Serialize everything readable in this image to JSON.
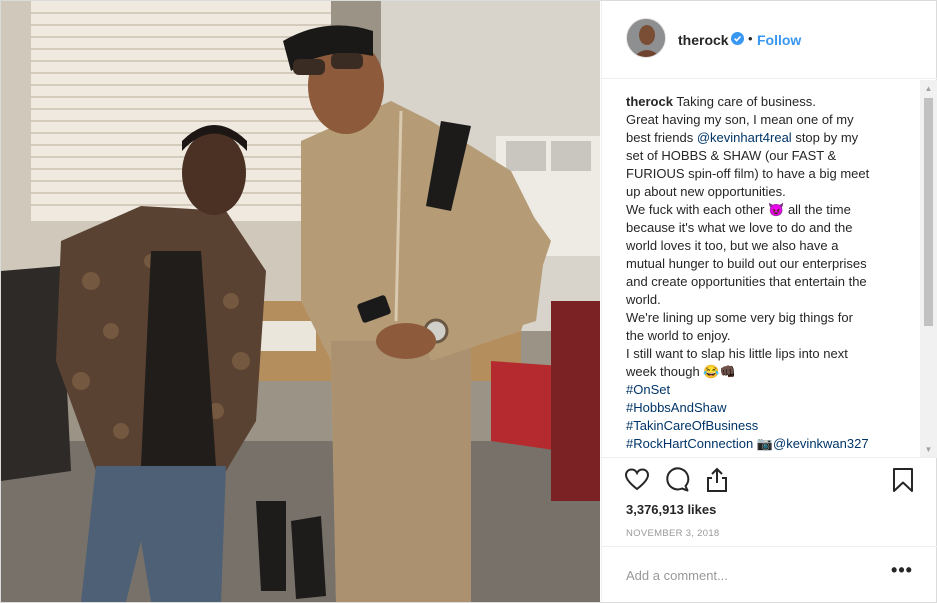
{
  "post": {
    "username": "therock",
    "follow_label": "Follow",
    "separator": "•",
    "caption_lines": [
      "Great having my son, I mean one of my",
      "best friends",
      "stop by my",
      "set of HOBBS & SHAW (our FAST &",
      "FURIOUS spin-off film) to have a big meet",
      "up about new opportunities.",
      "We fuck with each other",
      "all the time",
      "because it's what we love to do and the",
      "world loves it too, but we also have a",
      "mutual hunger to build out our enterprises",
      "and create opportunities that entertain the",
      "world.",
      "We're lining up some very big things for",
      "the world to enjoy.",
      "I still want to slap his little lips into next",
      "week though"
    ],
    "caption_first": "Taking care of business.",
    "mention": "@kevinhart4real",
    "emoji_devil": "😈",
    "emoji_laugh_fist": "😂👊🏿",
    "hashtags": [
      "#OnSet",
      "#HobbsAndShaw",
      "#TakinCareOfBusiness",
      "#RockHartConnection"
    ],
    "camera_emoji": "📷",
    "photo_credit": "@kevinkwan327",
    "likes": "3,376,913 likes",
    "date": "NOVEMBER 3, 2018",
    "comment_placeholder": "Add a comment...",
    "more_label": "•••"
  },
  "icons": [
    "verified-badge-icon",
    "heart-icon",
    "comment-icon",
    "share-icon",
    "bookmark-icon"
  ],
  "colors": {
    "link": "#003569",
    "follow": "#3897f0",
    "muted": "#999999",
    "verified": "#3897f0"
  }
}
